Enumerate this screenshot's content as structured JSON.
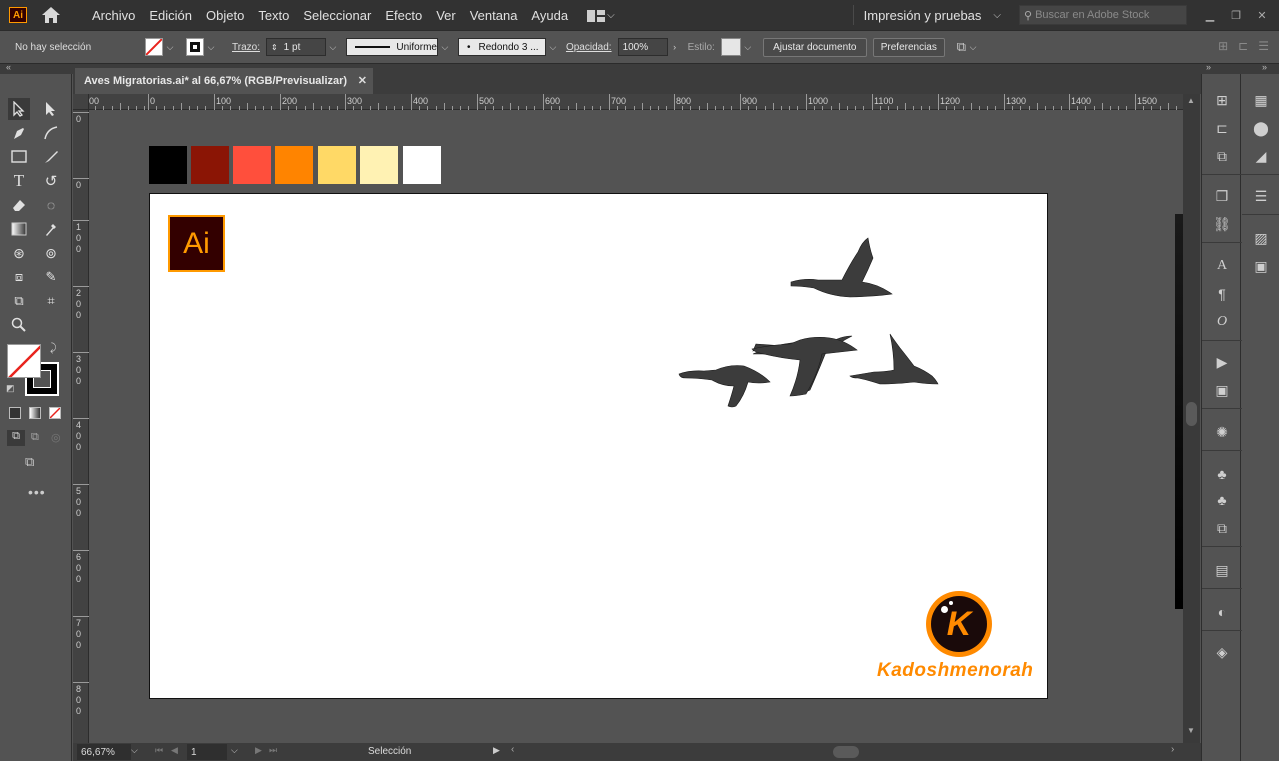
{
  "app": {
    "logo": "Ai",
    "accent": "#ff9a00"
  },
  "menu": {
    "items": [
      "Archivo",
      "Edición",
      "Objeto",
      "Texto",
      "Seleccionar",
      "Efecto",
      "Ver",
      "Ventana",
      "Ayuda"
    ],
    "workspace": "Impresión y pruebas",
    "search_placeholder": "Buscar en Adobe Stock"
  },
  "control": {
    "selection": "No hay selección",
    "stroke_label": "Trazo:",
    "stroke_weight": "1 pt",
    "stroke_profile": "Uniforme",
    "brush": "Redondo 3 ...",
    "opacity_label": "Opacidad:",
    "opacity": "100%",
    "style_label": "Estilo:",
    "fit_button": "Ajustar documento",
    "prefs_button": "Preferencias"
  },
  "document": {
    "tab_title": "Aves Migratorias.ai* al 66,67% (RGB/Previsualizar)",
    "zoom": "66,67%",
    "artboard_number": "1",
    "status_tool": "Selección"
  },
  "ruler": {
    "top": [
      "00",
      "0",
      "100",
      "200",
      "300",
      "400",
      "500",
      "600",
      "700",
      "800",
      "900",
      "1000",
      "1100",
      "1200",
      "1300",
      "1400",
      "1500"
    ],
    "left": [
      "0",
      "0",
      "1 0 0",
      "2 0 0",
      "3 0 0",
      "4 0 0",
      "5 0 0",
      "6 0 0",
      "7 0 0",
      "8 0 0"
    ]
  },
  "swatches": [
    "#000000",
    "#8b1505",
    "#ff4f3c",
    "#ff8400",
    "#ffd966",
    "#fff2b3",
    "#ffffff"
  ],
  "artboard": {
    "ai_logo_text": "Ai",
    "brand_name": "Kadoshmenorah",
    "brand_initial": "K"
  }
}
